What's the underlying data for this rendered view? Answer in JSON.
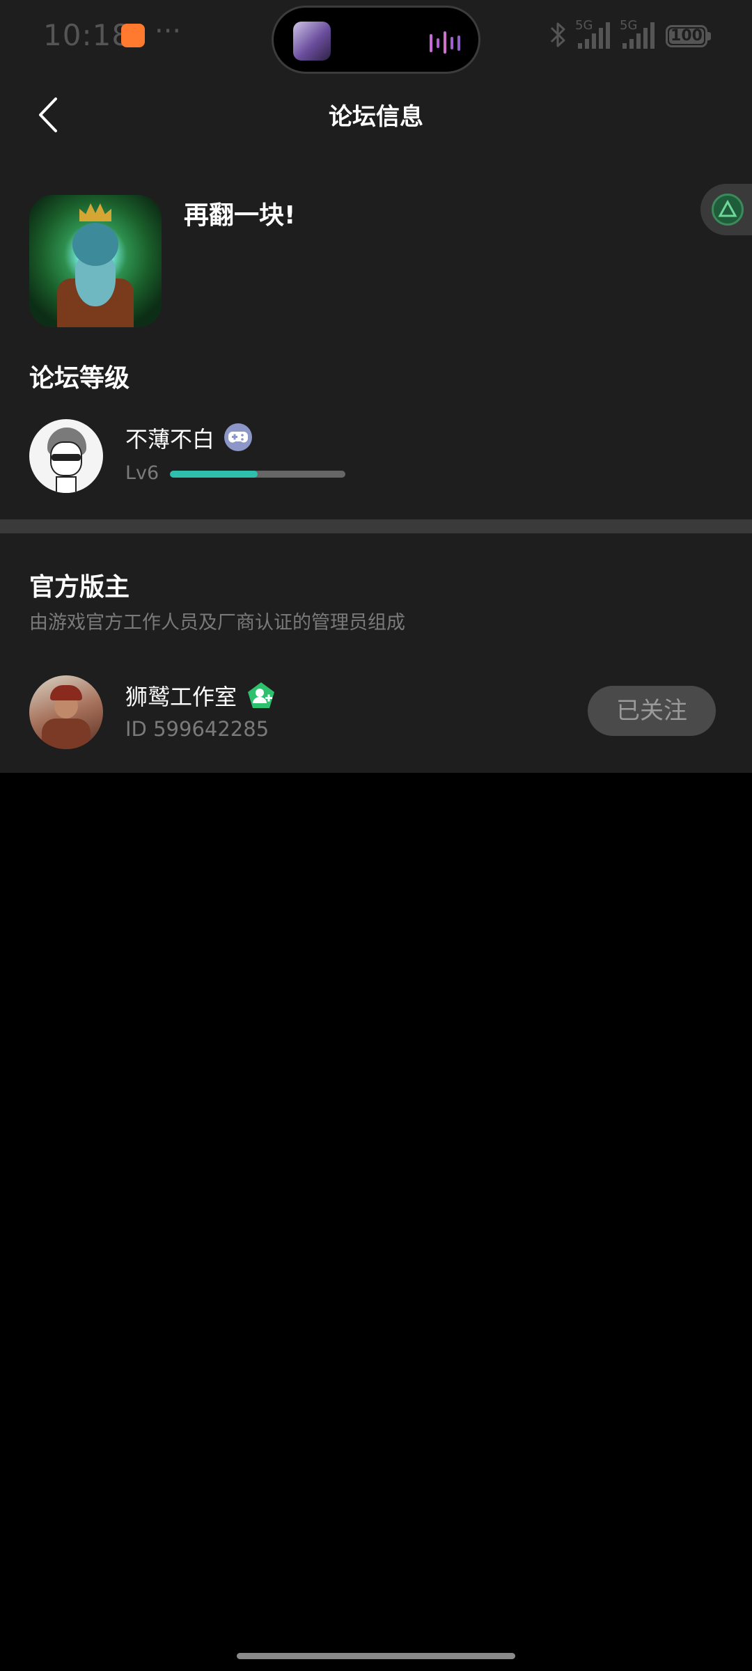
{
  "status_bar": {
    "time": "10:18",
    "more": "···",
    "network_1": "5G",
    "network_2": "5G",
    "battery": "100"
  },
  "header": {
    "title": "论坛信息"
  },
  "forum": {
    "name": "再翻一块!",
    "level_section_title": "论坛等级"
  },
  "user": {
    "name": "不薄不白",
    "level": "Lv6",
    "level_progress": 0.5
  },
  "moderators": {
    "title": "官方版主",
    "description": "由游戏官方工作人员及厂商认证的管理员组成",
    "items": [
      {
        "name": "狮鹫工作室",
        "id": "ID 599642285",
        "follow_label": "已关注"
      }
    ]
  },
  "colors": {
    "panel_bg": "#1e1e1e",
    "divider": "#3a3a3a",
    "accent_progress": "#2fbfae",
    "verify_badge": "#2dc16e"
  }
}
